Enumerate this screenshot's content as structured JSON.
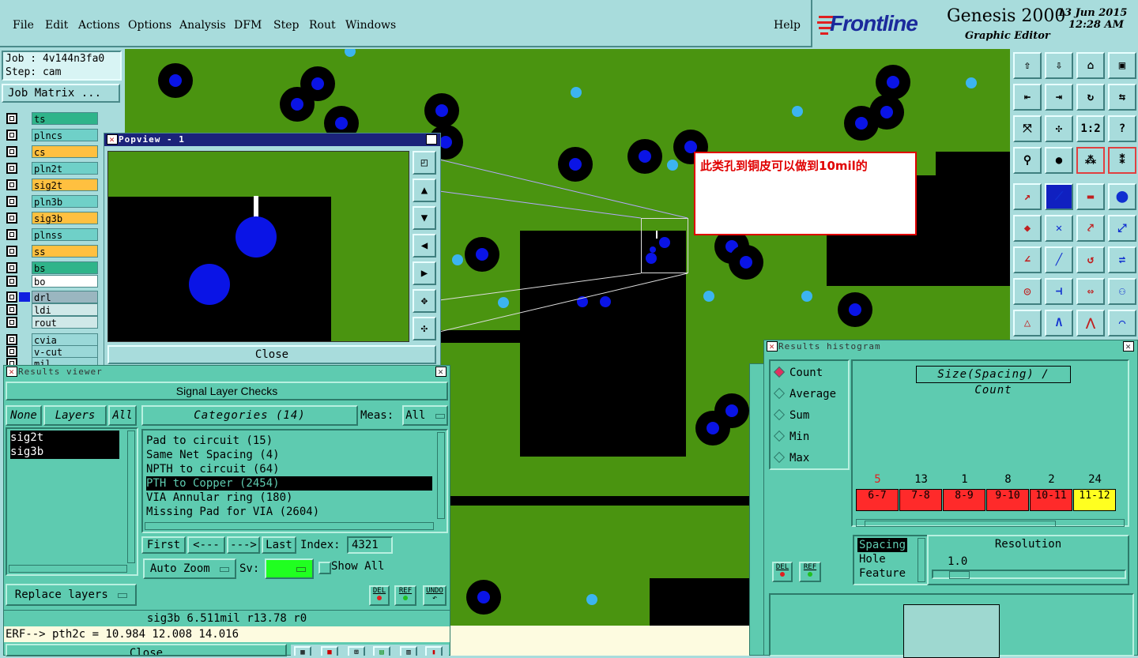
{
  "menu": {
    "items": [
      "File",
      "Edit",
      "Actions",
      "Options",
      "Analysis",
      "DFM",
      "Step",
      "Rout",
      "Windows"
    ],
    "help": "Help"
  },
  "brand": {
    "logo_text": "Frontline",
    "product": "Genesis 2000",
    "subtitle": "Graphic Editor",
    "date": "13 Jun 2015",
    "time": "12:28 AM"
  },
  "job": {
    "job_line": "Job : 4v144n3fa0",
    "step_line": "Step: cam",
    "matrix_button": "Job Matrix ..."
  },
  "layers": [
    {
      "name": "ts",
      "color": "#2fb48a"
    },
    {
      "name": "plncs",
      "color": "#6fd0c8"
    },
    {
      "name": "cs",
      "color": "#ffc040"
    },
    {
      "name": "pln2t",
      "color": "#6fd0c8"
    },
    {
      "name": "sig2t",
      "color": "#ffc040"
    },
    {
      "name": "pln3b",
      "color": "#6fd0c8"
    },
    {
      "name": "sig3b",
      "color": "#ffc040"
    },
    {
      "name": "plnss",
      "color": "#6fd0c8"
    },
    {
      "name": "ss",
      "color": "#ffc040"
    },
    {
      "name": "bs",
      "color": "#2fb48a"
    },
    {
      "name": "bo",
      "color": "#ffffff"
    },
    {
      "name": "drl",
      "color": "#9ab6c0"
    },
    {
      "name": "ldi",
      "color": "#d0e8e8"
    },
    {
      "name": "rout",
      "color": "#d0e8e8"
    },
    {
      "name": "cvia",
      "color": "#9ad8d8"
    },
    {
      "name": "v-cut",
      "color": "#9ad8d8"
    },
    {
      "name": "mil",
      "color": "#9ad8d8"
    }
  ],
  "popview": {
    "title": "Popview - 1",
    "close": "Close"
  },
  "annotation": {
    "text": "此类孔到铜皮可以做到10mil的"
  },
  "results_viewer": {
    "title": "Results viewer",
    "header": "Signal Layer Checks",
    "none_btn": "None",
    "layers_btn": "Layers",
    "all_btn": "All",
    "layer_list": [
      "sig2t",
      "sig3b"
    ],
    "categories_label": "Categories (14)",
    "meas_label": "Meas:",
    "meas_value": "All",
    "categories": [
      "Pad to circuit (15)",
      "Same Net Spacing (4)",
      "NPTH to circuit (64)",
      "PTH to Copper (2454)",
      "VIA Annular ring (180)",
      "Missing Pad for VIA (2604)"
    ],
    "selected_category": 3,
    "first": "First",
    "prev": "<---",
    "next": "--->",
    "last": "Last",
    "index_label": "Index:",
    "index_value": "4321",
    "auto_zoom": "Auto Zoom",
    "sv_label": "Sv:",
    "show_all": "Show All",
    "replace_layers": "Replace layers",
    "del": "DEL",
    "ref": "REF",
    "undo": "UNDO",
    "status": "sig3b 6.511mil  r13.78  r0",
    "erf": "ERF--> pth2c = 10.984 12.008 14.016",
    "close": "Close"
  },
  "histogram": {
    "title": "Results histogram",
    "options": [
      "Count",
      "Average",
      "Sum",
      "Min",
      "Max"
    ],
    "selected_option": 0,
    "chart_title": "Size(Spacing) / Count",
    "counts": [
      "5",
      "13",
      "1",
      "8",
      "2",
      "24"
    ],
    "bins": [
      "6-7",
      "7-8",
      "8-9",
      "9-10",
      "10-11",
      "11-12"
    ],
    "bin_colors": [
      "#ff2a2a",
      "#ff2a2a",
      "#ff2a2a",
      "#ff2a2a",
      "#ff2a2a",
      "#ffff20"
    ],
    "modes": [
      "Spacing",
      "Hole",
      "Feature"
    ],
    "resolution_label": "Resolution",
    "resolution_value": "1.0",
    "del": "DEL",
    "ref": "REF"
  },
  "toolbox": {
    "icons": [
      "zoom-home-icon",
      "zoom-back-icon",
      "home-icon",
      "window-icon",
      "pan-left-icon",
      "pan-right-icon",
      "rotate-icon",
      "mirror-icon",
      "fit-all-icon",
      "center-icon",
      "scale-1-2-icon",
      "help-icon",
      "measure-icon",
      "snap-icon",
      "net-icon",
      "layer-icon",
      "select-icon",
      "highlight-icon",
      "ruler-icon",
      "pad-icon",
      "connect-icon",
      "cross-icon",
      "add-net-icon",
      "move-icon",
      "angle-icon",
      "line-icon",
      "arc-icon",
      "flip-icon",
      "drill-icon",
      "split-icon",
      "bus-icon",
      "group-icon",
      "triangle-icon",
      "a-frame-icon",
      "span-icon",
      "bridge-icon"
    ],
    "labels": {
      "scale": "1:2",
      "question": "?"
    }
  }
}
